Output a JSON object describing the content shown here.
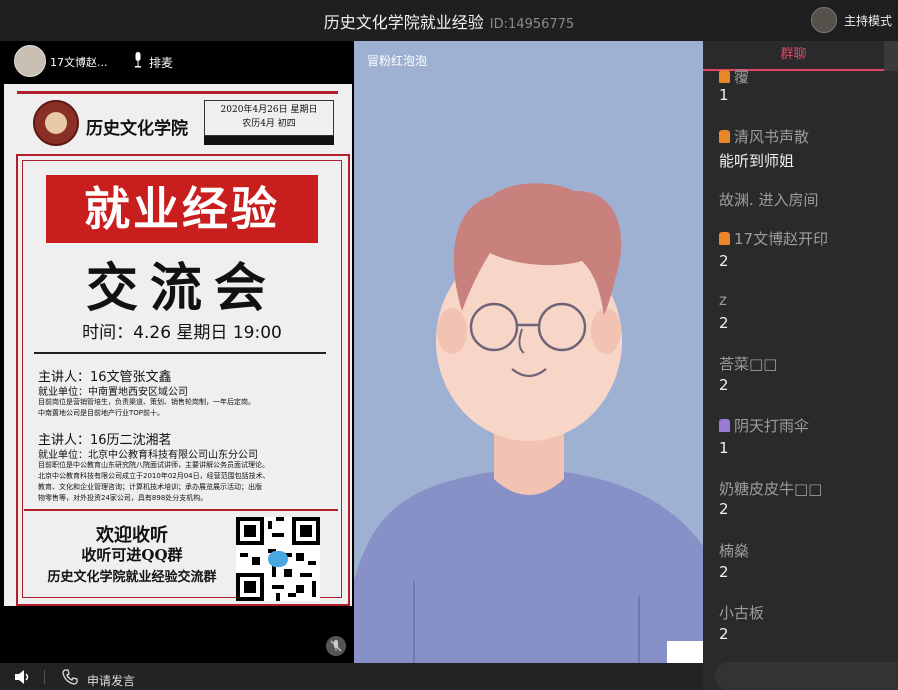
{
  "header": {
    "title": "历史文化学院就业经验",
    "room_id": "ID:14956775",
    "host_mode": "主持模式"
  },
  "speaker": {
    "name": "17文博赵...",
    "queue_label": "排麦"
  },
  "poster": {
    "school": "历史文化学院",
    "date_line1": "2020年4月26日 星期日",
    "date_line2": "农历4月 初四",
    "hero_line1": "就业经验",
    "hero_line2": "交流会",
    "time_line": "时间：4.26  星期日  19:00",
    "speaker1_title": "主讲人：16文管张文鑫",
    "speaker1_unit": "就业单位：中南置地西安区域公司",
    "speaker1_desc1": "目前岗位是营销管培生，负责渠道、策划、销售轮岗制，一年后定岗。",
    "speaker1_desc2": "中南置地公司是目前地产行业TOP前十。",
    "speaker2_title": "主讲人：16历二沈湘茗",
    "speaker2_unit": "就业单位：北京中公教育科技有限公司山东分公司",
    "speaker2_desc1": "目前职位是中公教育山东研究院八院面试讲师，主要讲解公务员面试理论。",
    "speaker2_desc2": "北京中公教育科技有限公司成立于2010年02月04日，经营范围包括技术、",
    "speaker2_desc3": "教育、文化和企业管理咨询；计算机技术培训；承办展览展示活动；出版",
    "speaker2_desc4": "物零售等，对外投资24家公司，具有898处分支机构。",
    "welcome1": "欢迎收听",
    "welcome2": "收听可进QQ群",
    "welcome3": "历史文化学院就业经验交流群"
  },
  "video": {
    "participant": "冒粉红泡泡"
  },
  "chat": {
    "tab_label": "群聊",
    "messages": [
      {
        "name": "䨱",
        "text": "1",
        "badge": "#e8862a"
      },
      {
        "name": "清风书声散",
        "text": "能听到师姐",
        "badge": "#e8862a"
      },
      {
        "name": "故渊. 进入房间",
        "text": "",
        "badge": ""
      },
      {
        "name": "17文博赵开印",
        "text": "2",
        "badge": "#e8862a"
      },
      {
        "name": "z",
        "text": "2",
        "badge": ""
      },
      {
        "name": "荅菜□□",
        "text": "2",
        "badge": ""
      },
      {
        "name": "阴天打雨伞",
        "text": "1",
        "badge": "#9b7ad6"
      },
      {
        "name": "奶糖皮皮牛□□",
        "text": "2",
        "badge": ""
      },
      {
        "name": "楠燊",
        "text": "2",
        "badge": ""
      },
      {
        "name": "小古板",
        "text": "2",
        "badge": ""
      }
    ]
  },
  "bottom": {
    "apply_label": "申请发言"
  }
}
